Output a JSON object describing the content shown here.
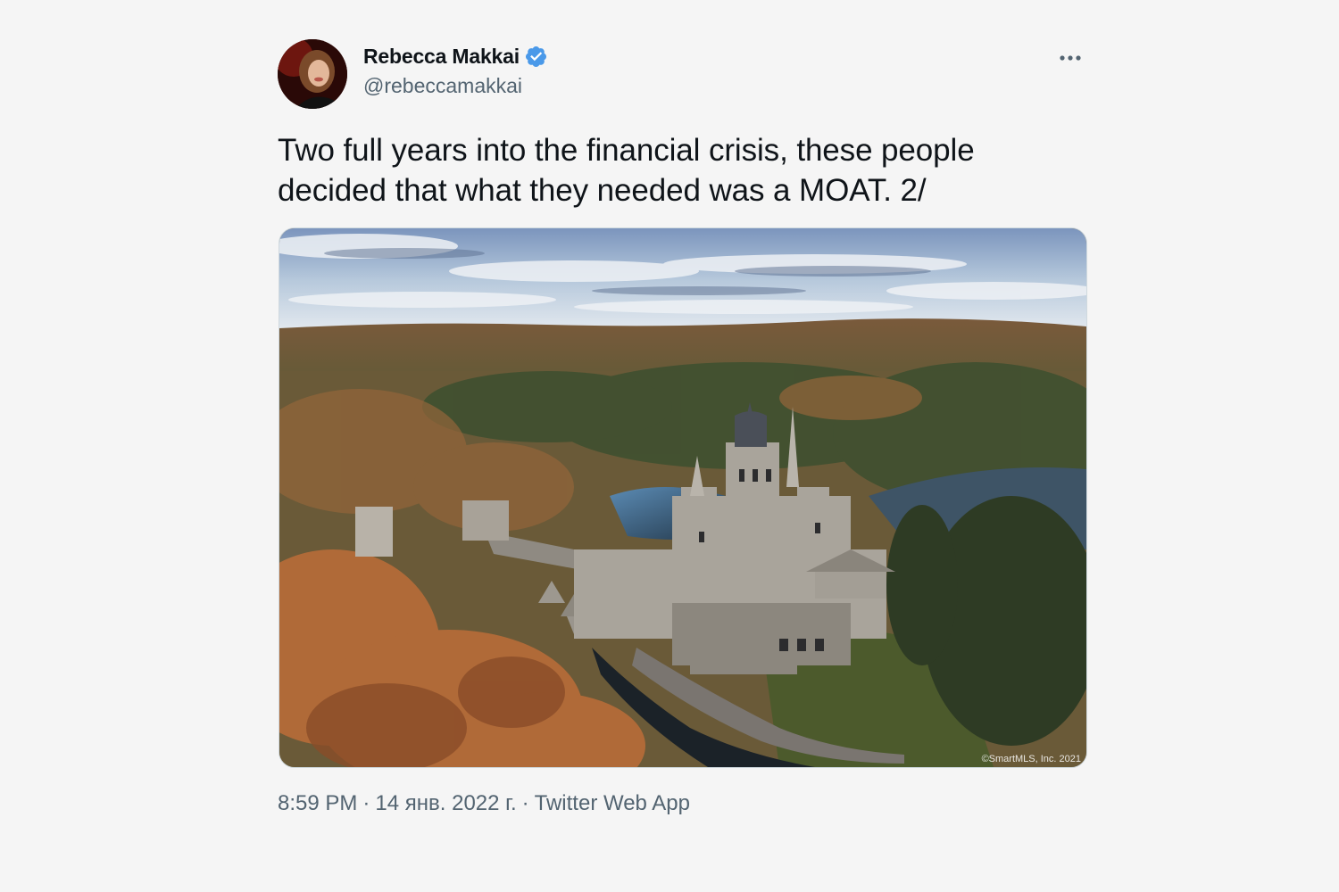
{
  "user": {
    "display_name": "Rebecca Makkai",
    "handle": "@rebeccamakkai",
    "verified": true,
    "verified_color": "#4a99e9"
  },
  "tweet": {
    "text": "Two full years into the financial crisis, these people decided that what they needed was a MOAT. 2/",
    "media_alt_icon": "castle-photo",
    "media_credit": "©SmartMLS, Inc.  2021"
  },
  "meta": {
    "time": "8:59 PM",
    "date": "14 янв. 2022 г.",
    "separator": "·",
    "source": "Twitter Web App"
  },
  "icons": {
    "more": "more-horizontal-icon",
    "verified": "verified-badge-icon"
  }
}
